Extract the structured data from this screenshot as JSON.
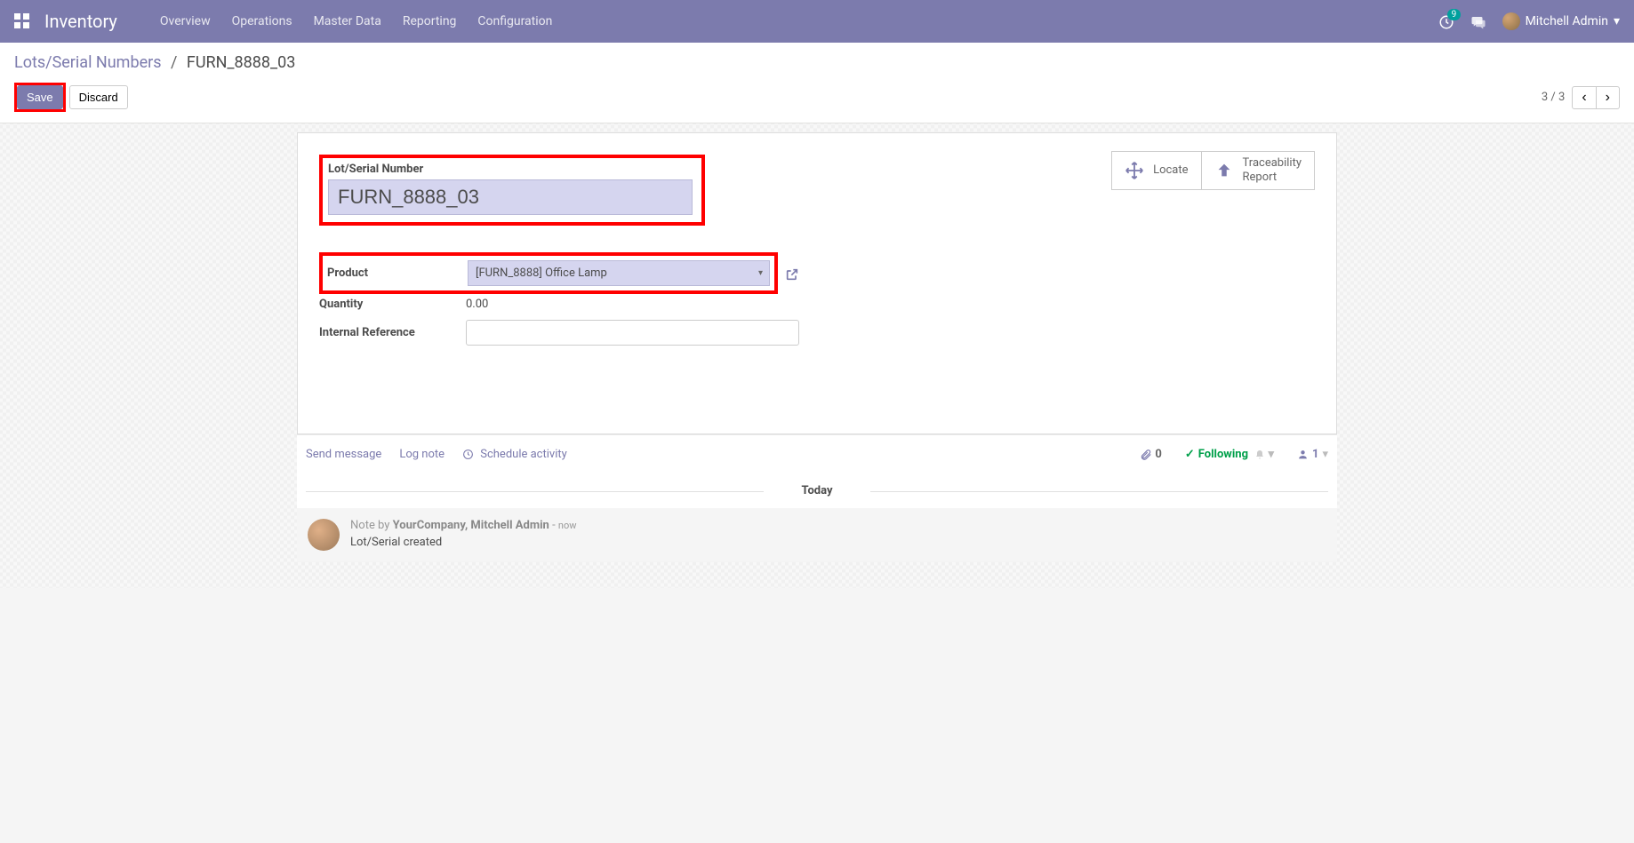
{
  "nav": {
    "app_title": "Inventory",
    "items": [
      "Overview",
      "Operations",
      "Master Data",
      "Reporting",
      "Configuration"
    ],
    "activity_count": "9",
    "user_name": "Mitchell Admin"
  },
  "control": {
    "breadcrumb_root": "Lots/Serial Numbers",
    "breadcrumb_current": "FURN_8888_03",
    "save_label": "Save",
    "discard_label": "Discard",
    "pager_text": "3 / 3"
  },
  "stat": {
    "locate": "Locate",
    "trace1": "Traceability",
    "trace2": "Report"
  },
  "form": {
    "title_label": "Lot/Serial Number",
    "title_value": "FURN_8888_03",
    "product_label": "Product",
    "product_value": "[FURN_8888] Office Lamp",
    "quantity_label": "Quantity",
    "quantity_value": "0.00",
    "ref_label": "Internal Reference",
    "ref_value": ""
  },
  "chatter": {
    "send_message": "Send message",
    "log_note": "Log note",
    "schedule": "Schedule activity",
    "attach_count": "0",
    "following": "Following",
    "followers_count": "1",
    "today": "Today",
    "note_prefix": "Note by ",
    "note_author": "YourCompany, Mitchell Admin",
    "note_time": "now",
    "note_body": "Lot/Serial created"
  }
}
